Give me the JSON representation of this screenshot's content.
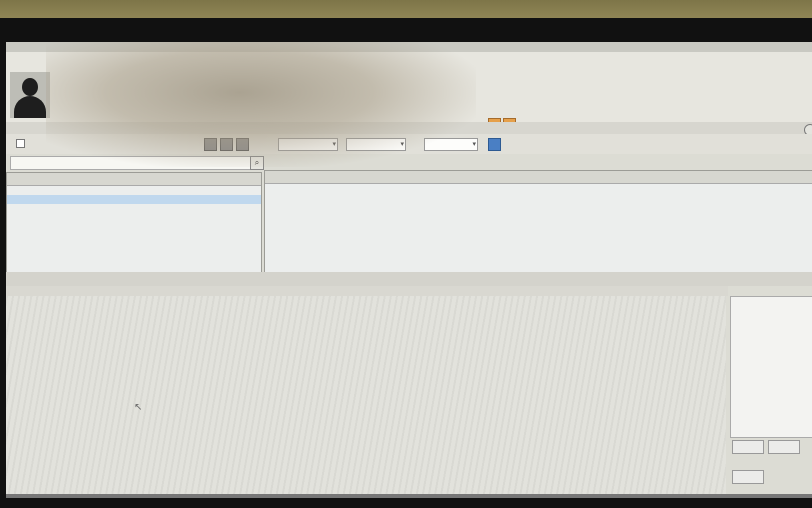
{
  "app": {
    "name_masked": true,
    "accent_color": "#4a7fc4",
    "toolbar_icon_color": "#e6a04a"
  },
  "toolbar": {
    "icons": [
      "warning-icon",
      "warning-icon"
    ]
  },
  "tabs": [
    {
      "label": ""
    },
    {
      "label": ""
    },
    {
      "label": ""
    }
  ],
  "options": {
    "checkbox_label": "",
    "dropdown_1": "",
    "dropdown_2": "",
    "dropdown_3_label": "",
    "dropdown_3": ""
  },
  "search": {
    "value": "",
    "placeholder": ""
  },
  "left_table": {
    "columns": [
      "",
      ""
    ],
    "rows": [
      ""
    ]
  },
  "right_table": {
    "columns": [
      "",
      "",
      "",
      "",
      "",
      ""
    ]
  },
  "mid_bar": {
    "label": "",
    "value": ""
  },
  "bottom_panel": {
    "label": ""
  },
  "right_panel": {
    "label": "",
    "buttons": [
      "",
      "",
      ""
    ]
  }
}
